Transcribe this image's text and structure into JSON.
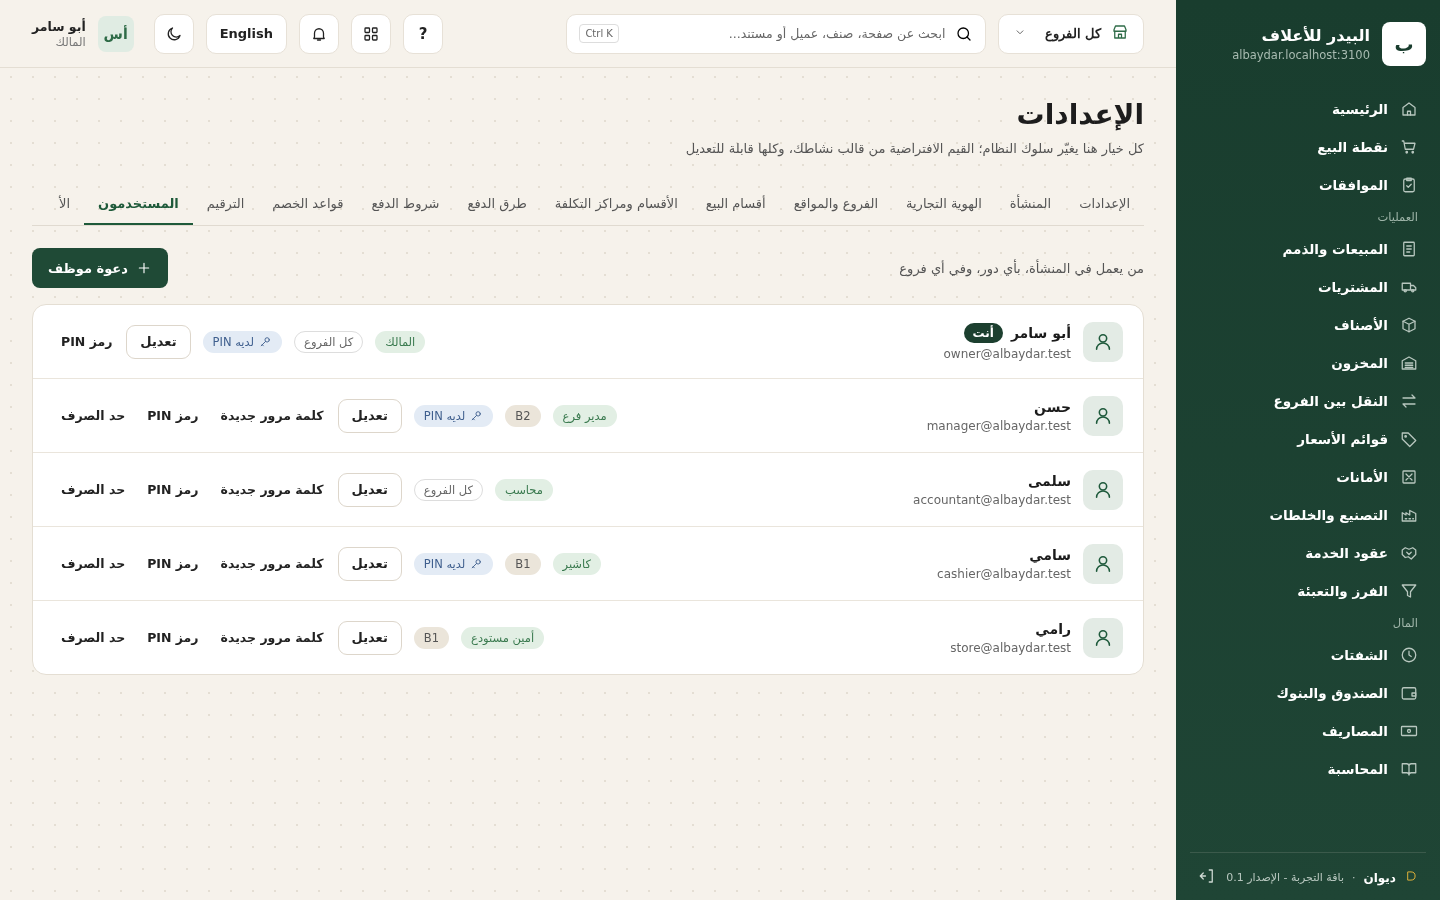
{
  "sidebar": {
    "logo": "ب",
    "title": "البيدر للأعلاف",
    "subtitle": "albaydar.localhost:3100",
    "groups": [
      {
        "items": [
          {
            "label": "الرئيسية"
          },
          {
            "label": "نقطة البيع"
          },
          {
            "label": "الموافقات"
          }
        ]
      },
      {
        "label": "العمليات",
        "items": [
          {
            "label": "المبيعات والذمم"
          },
          {
            "label": "المشتريات"
          },
          {
            "label": "الأصناف"
          },
          {
            "label": "المخزون"
          },
          {
            "label": "النقل بين الفروع"
          },
          {
            "label": "قوائم الأسعار"
          },
          {
            "label": "الأمانات"
          },
          {
            "label": "التصنيع والخلطات"
          },
          {
            "label": "عقود الخدمة"
          },
          {
            "label": "الفرز والتعبئة"
          }
        ]
      },
      {
        "label": "المال",
        "items": [
          {
            "label": "الشفتات"
          },
          {
            "label": "الصندوق والبنوك"
          },
          {
            "label": "المصاريف"
          },
          {
            "label": "المحاسبة"
          }
        ]
      }
    ],
    "footer": {
      "brand": "ديوان",
      "separator": "·",
      "plan": "باقة التجربة - الإصدار 0.1"
    }
  },
  "topbar": {
    "branch_select": "كل الفروع",
    "search": {
      "placeholder": "ابحث عن صفحة، صنف، عميل أو مستند...",
      "shortcut": "Ctrl K"
    },
    "help": "?",
    "language": "English",
    "user": {
      "initials": "أس",
      "name": "أبو سامر",
      "role": "المالك"
    }
  },
  "page": {
    "title": "الإعدادات",
    "subtitle": "كل خيار هنا يغيّر سلوك النظام؛ القيم الافتراضية من قالب نشاطك، وكلها قابلة للتعديل"
  },
  "tabs": [
    {
      "label": "الإعدادات",
      "selected": false
    },
    {
      "label": "المنشأة",
      "selected": false
    },
    {
      "label": "الهوية التجارية",
      "selected": false
    },
    {
      "label": "الفروع والمواقع",
      "selected": false
    },
    {
      "label": "أقسام البيع",
      "selected": false
    },
    {
      "label": "الأقسام ومراكز التكلفة",
      "selected": false
    },
    {
      "label": "طرق الدفع",
      "selected": false
    },
    {
      "label": "شروط الدفع",
      "selected": false
    },
    {
      "label": "قواعد الخصم",
      "selected": false
    },
    {
      "label": "الترقيم",
      "selected": false
    },
    {
      "label": "المستخدمون",
      "selected": true
    },
    {
      "label": "الأ",
      "selected": false
    }
  ],
  "users_section": {
    "description": "من يعمل في المنشأة، بأي دور، وفي أي فروع",
    "invite_button": "دعوة موظف",
    "users": [
      {
        "name": "أبو سامر",
        "you_badge": "أنت",
        "email": "owner@albaydar.test",
        "tags": [
          {
            "kind": "role",
            "label": "المالك"
          },
          {
            "kind": "all_branches",
            "label": "كل الفروع"
          },
          {
            "kind": "pin",
            "label": "لديه PIN"
          }
        ],
        "actions": [
          {
            "kind": "button",
            "label": "تعديل"
          },
          {
            "kind": "link",
            "label": "رمز PIN"
          }
        ]
      },
      {
        "name": "حسن",
        "email": "manager@albaydar.test",
        "tags": [
          {
            "kind": "role",
            "label": "مدير فرع"
          },
          {
            "kind": "branch",
            "label": "B2"
          },
          {
            "kind": "pin",
            "label": "لديه PIN"
          }
        ],
        "actions": [
          {
            "kind": "button",
            "label": "تعديل"
          },
          {
            "kind": "link",
            "label": "كلمة مرور جديدة"
          },
          {
            "kind": "link",
            "label": "رمز PIN"
          },
          {
            "kind": "link",
            "label": "حد الصرف"
          }
        ]
      },
      {
        "name": "سلمى",
        "email": "accountant@albaydar.test",
        "tags": [
          {
            "kind": "role",
            "label": "محاسب"
          },
          {
            "kind": "all_branches",
            "label": "كل الفروع"
          }
        ],
        "actions": [
          {
            "kind": "button",
            "label": "تعديل"
          },
          {
            "kind": "link",
            "label": "كلمة مرور جديدة"
          },
          {
            "kind": "link",
            "label": "رمز PIN"
          },
          {
            "kind": "link",
            "label": "حد الصرف"
          }
        ]
      },
      {
        "name": "سامي",
        "email": "cashier@albaydar.test",
        "tags": [
          {
            "kind": "role",
            "label": "كاشير"
          },
          {
            "kind": "branch",
            "label": "B1"
          },
          {
            "kind": "pin",
            "label": "لديه PIN"
          }
        ],
        "actions": [
          {
            "kind": "button",
            "label": "تعديل"
          },
          {
            "kind": "link",
            "label": "كلمة مرور جديدة"
          },
          {
            "kind": "link",
            "label": "رمز PIN"
          },
          {
            "kind": "link",
            "label": "حد الصرف"
          }
        ]
      },
      {
        "name": "رامي",
        "email": "store@albaydar.test",
        "tags": [
          {
            "kind": "role",
            "label": "أمين مستودع"
          },
          {
            "kind": "branch",
            "label": "B1"
          }
        ],
        "actions": [
          {
            "kind": "button",
            "label": "تعديل"
          },
          {
            "kind": "link",
            "label": "كلمة مرور جديدة"
          },
          {
            "kind": "link",
            "label": "رمز PIN"
          },
          {
            "kind": "link",
            "label": "حد الصرف"
          }
        ]
      }
    ]
  }
}
